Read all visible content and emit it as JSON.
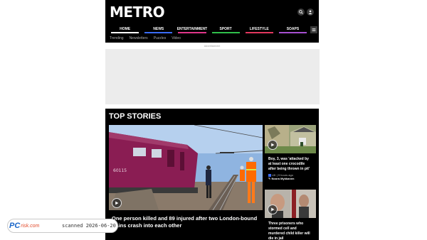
{
  "header": {
    "logo": "METRO",
    "nav": [
      {
        "label": "HOME",
        "color": "#ffffff"
      },
      {
        "label": "NEWS",
        "color": "#3a6cf5"
      },
      {
        "label": "ENTERTAINMENT",
        "color": "#e0368a"
      },
      {
        "label": "SPORT",
        "color": "#2fbf4a"
      },
      {
        "label": "LIFESTYLE",
        "color": "#e2375f"
      },
      {
        "label": "SOAPS",
        "color": "#a64fd1"
      }
    ],
    "subnav": [
      "Trending",
      "Newsletters",
      "Puzzles",
      "Video"
    ],
    "icons": [
      "search-icon",
      "user-icon",
      "menu-icon"
    ]
  },
  "ad": {
    "label": "Advertisement"
  },
  "top_stories": {
    "title": "TOP STORIES",
    "hero": {
      "headline": "One person killed and 89 injured after two London-bound trains crash into each other",
      "train_number": "60115"
    },
    "side": [
      {
        "headline": "Boy, 3, was 'attacked by at least one crocodile after being thrown in pit'",
        "meta": "UK | 9 hours ago",
        "author": "Noora Mykkanen"
      },
      {
        "headline": "Three prisoners who stormed cell and murdered child killer will die in jail",
        "meta": "",
        "author": ""
      }
    ]
  },
  "watermark": {
    "brand": "PC",
    "brand_suffix": "risk.com",
    "text": "scanned 2026-06-20"
  }
}
